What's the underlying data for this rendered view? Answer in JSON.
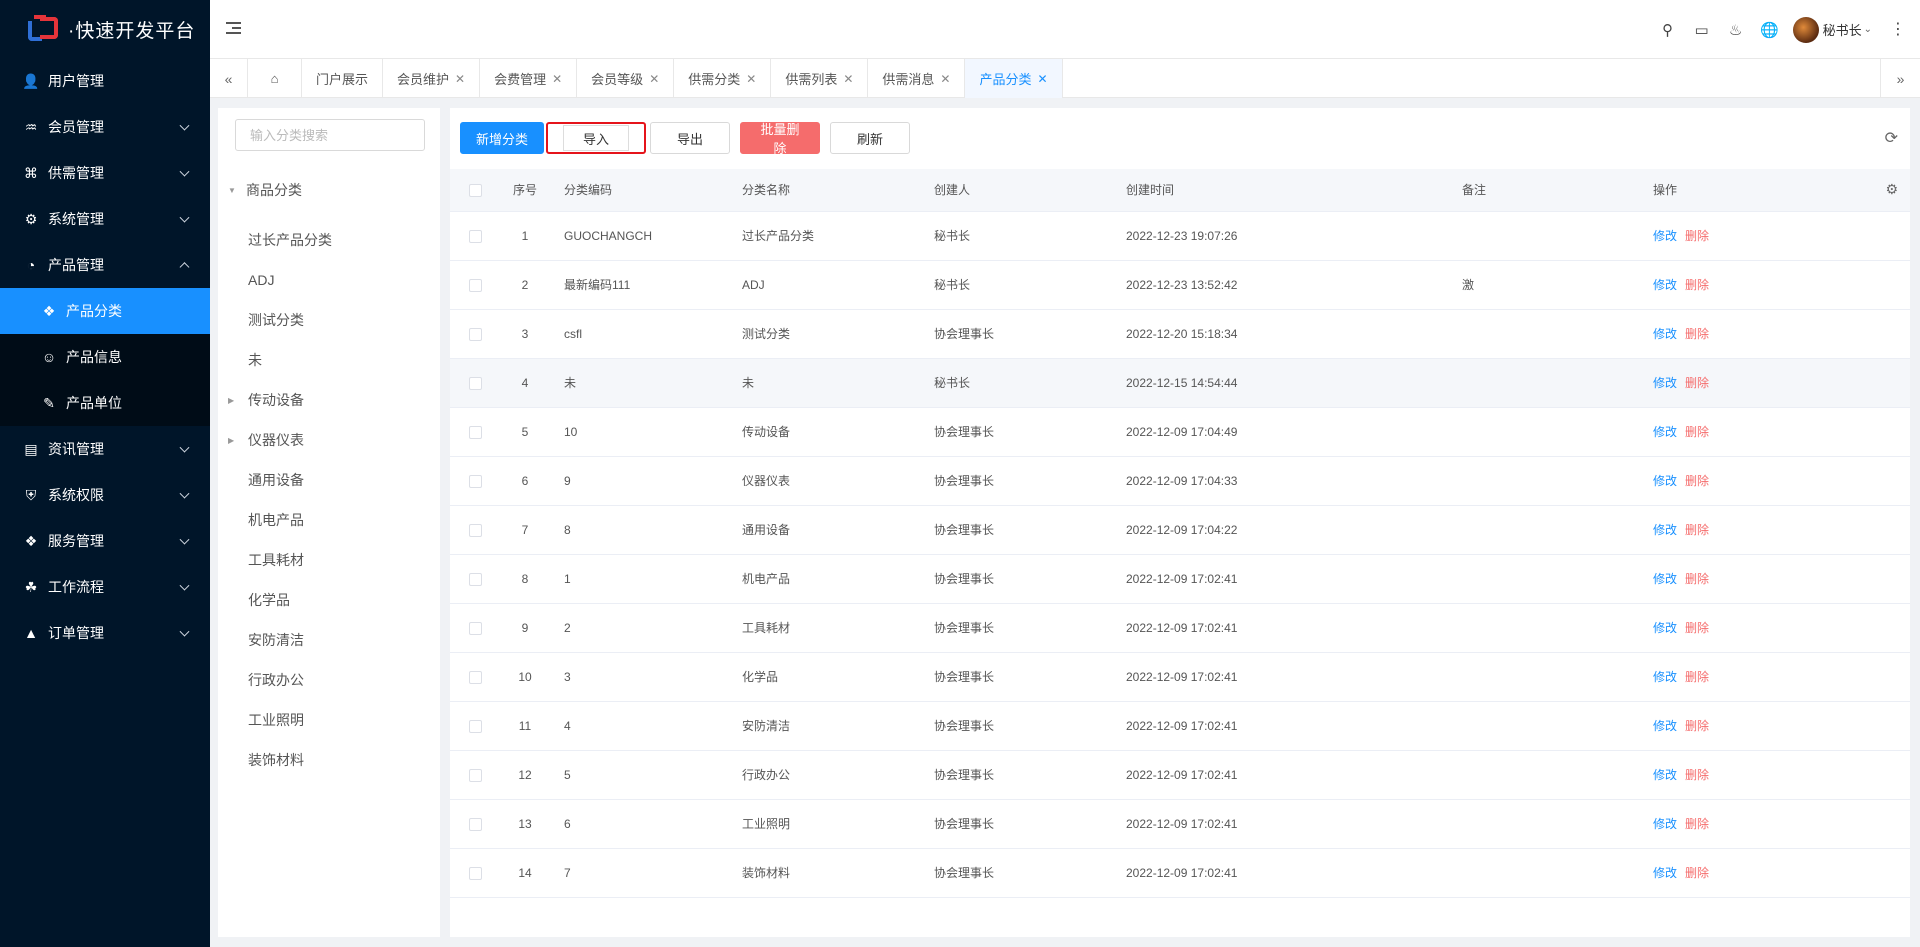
{
  "app": {
    "title": "·快速开发平台"
  },
  "sidebar": {
    "items": [
      {
        "label": "用户管理",
        "icon": "user-icon",
        "expandable": false
      },
      {
        "label": "会员管理",
        "icon": "member-icon",
        "expandable": true
      },
      {
        "label": "供需管理",
        "icon": "supply-icon",
        "expandable": true
      },
      {
        "label": "系统管理",
        "icon": "gear-icon",
        "expandable": true
      },
      {
        "label": "产品管理",
        "icon": "product-icon",
        "expandable": true,
        "expanded": true
      }
    ],
    "submenu": [
      {
        "label": "产品分类",
        "icon": "category-icon",
        "active": true
      },
      {
        "label": "产品信息",
        "icon": "person-icon"
      },
      {
        "label": "产品单位",
        "icon": "pen-icon"
      }
    ],
    "items_after": [
      {
        "label": "资讯管理",
        "icon": "document-icon"
      },
      {
        "label": "系统权限",
        "icon": "shield-icon"
      },
      {
        "label": "服务管理",
        "icon": "service-icon"
      },
      {
        "label": "工作流程",
        "icon": "workflow-icon"
      },
      {
        "label": "订单管理",
        "icon": "order-icon"
      }
    ]
  },
  "header": {
    "user_name": "秘书长"
  },
  "tabs": [
    {
      "label": "门户展示",
      "closable": false
    },
    {
      "label": "会员维护",
      "closable": true
    },
    {
      "label": "会费管理",
      "closable": true
    },
    {
      "label": "会员等级",
      "closable": true
    },
    {
      "label": "供需分类",
      "closable": true
    },
    {
      "label": "供需列表",
      "closable": true
    },
    {
      "label": "供需消息",
      "closable": true
    },
    {
      "label": "产品分类",
      "closable": true,
      "active": true
    }
  ],
  "tree": {
    "search_placeholder": "输入分类搜索",
    "root": "商品分类",
    "nodes": [
      {
        "label": "过长产品分类",
        "has_children": false
      },
      {
        "label": "ADJ",
        "has_children": false
      },
      {
        "label": "测试分类",
        "has_children": false
      },
      {
        "label": "未",
        "has_children": false
      },
      {
        "label": "传动设备",
        "has_children": true
      },
      {
        "label": "仪器仪表",
        "has_children": true
      },
      {
        "label": "通用设备",
        "has_children": false
      },
      {
        "label": "机电产品",
        "has_children": false
      },
      {
        "label": "工具耗材",
        "has_children": false
      },
      {
        "label": "化学品",
        "has_children": false
      },
      {
        "label": "安防清洁",
        "has_children": false
      },
      {
        "label": "行政办公",
        "has_children": false
      },
      {
        "label": "工业照明",
        "has_children": false
      },
      {
        "label": "装饰材料",
        "has_children": false
      }
    ]
  },
  "toolbar": {
    "add_label": "新增分类",
    "import_label": "导入",
    "export_label": "导出",
    "batch_delete_label": "批量删除",
    "refresh_label": "刷新"
  },
  "table": {
    "headers": [
      "序号",
      "分类编码",
      "分类名称",
      "创建人",
      "创建时间",
      "备注",
      "操作"
    ],
    "edit_label": "修改",
    "delete_label": "删除",
    "rows": [
      {
        "no": "1",
        "code": "GUOCHANGCH",
        "name": "过长产品分类",
        "creator": "秘书长",
        "time": "2022-12-23 19:07:26",
        "remark": ""
      },
      {
        "no": "2",
        "code": "最新编码111",
        "name": "ADJ",
        "creator": "秘书长",
        "time": "2022-12-23 13:52:42",
        "remark": "激"
      },
      {
        "no": "3",
        "code": "csfl",
        "name": "测试分类",
        "creator": "协会理事长",
        "time": "2022-12-20 15:18:34",
        "remark": ""
      },
      {
        "no": "4",
        "code": "未",
        "name": "未",
        "creator": "秘书长",
        "time": "2022-12-15 14:54:44",
        "remark": "",
        "highlighted": true
      },
      {
        "no": "5",
        "code": "10",
        "name": "传动设备",
        "creator": "协会理事长",
        "time": "2022-12-09 17:04:49",
        "remark": ""
      },
      {
        "no": "6",
        "code": "9",
        "name": "仪器仪表",
        "creator": "协会理事长",
        "time": "2022-12-09 17:04:33",
        "remark": ""
      },
      {
        "no": "7",
        "code": "8",
        "name": "通用设备",
        "creator": "协会理事长",
        "time": "2022-12-09 17:04:22",
        "remark": ""
      },
      {
        "no": "8",
        "code": "1",
        "name": "机电产品",
        "creator": "协会理事长",
        "time": "2022-12-09 17:02:41",
        "remark": ""
      },
      {
        "no": "9",
        "code": "2",
        "name": "工具耗材",
        "creator": "协会理事长",
        "time": "2022-12-09 17:02:41",
        "remark": ""
      },
      {
        "no": "10",
        "code": "3",
        "name": "化学品",
        "creator": "协会理事长",
        "time": "2022-12-09 17:02:41",
        "remark": ""
      },
      {
        "no": "11",
        "code": "4",
        "name": "安防清洁",
        "creator": "协会理事长",
        "time": "2022-12-09 17:02:41",
        "remark": ""
      },
      {
        "no": "12",
        "code": "5",
        "name": "行政办公",
        "creator": "协会理事长",
        "time": "2022-12-09 17:02:41",
        "remark": ""
      },
      {
        "no": "13",
        "code": "6",
        "name": "工业照明",
        "creator": "协会理事长",
        "time": "2022-12-09 17:02:41",
        "remark": ""
      },
      {
        "no": "14",
        "code": "7",
        "name": "装饰材料",
        "creator": "协会理事长",
        "time": "2022-12-09 17:02:41",
        "remark": ""
      }
    ]
  },
  "colors": {
    "primary": "#1890ff",
    "danger": "#f56c6c",
    "sidebar_bg": "#001529",
    "highlight_border": "#e5141b"
  }
}
